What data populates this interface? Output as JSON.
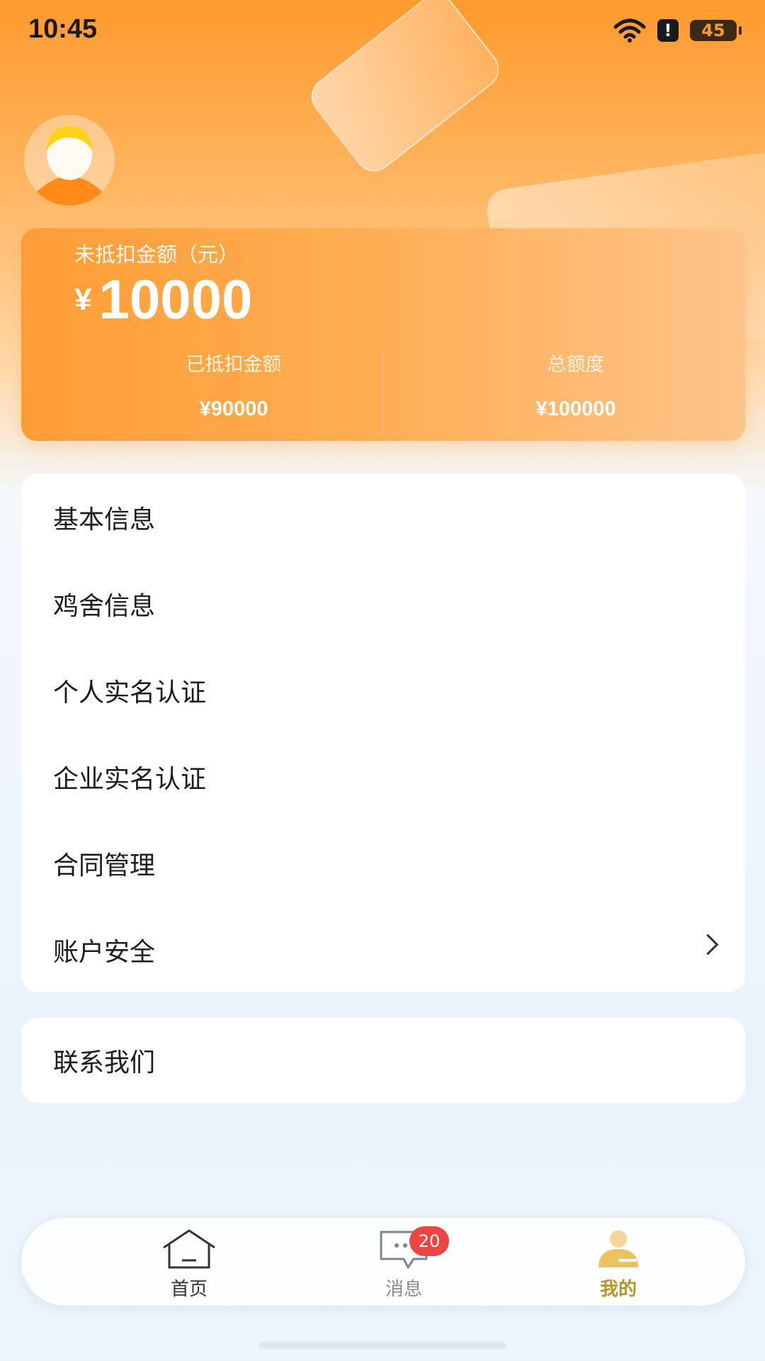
{
  "status_bar": {
    "time": "10:45",
    "battery": "45",
    "icons": [
      "wifi-icon",
      "alert-icon",
      "battery-icon"
    ]
  },
  "profile": {
    "avatar_icon": "user-avatar-icon"
  },
  "balance": {
    "label": "未抵扣金额（元）",
    "currency": "¥",
    "amount": "10000",
    "deducted_label": "已抵扣金额",
    "deducted_value": "¥90000",
    "total_label": "总额度",
    "total_value": "¥100000"
  },
  "menu": {
    "items": [
      {
        "label": "基本信息"
      },
      {
        "label": "鸡舍信息"
      },
      {
        "label": "个人实名认证"
      },
      {
        "label": "企业实名认证"
      },
      {
        "label": "合同管理"
      },
      {
        "label": "账户安全"
      }
    ],
    "contact": "联系我们"
  },
  "tabbar": {
    "home": "首页",
    "messages": "消息",
    "messages_badge": "20",
    "me": "我的"
  },
  "colors": {
    "accent": "#ff9d35",
    "active_tab": "#b8922a",
    "badge": "#ee4444"
  }
}
